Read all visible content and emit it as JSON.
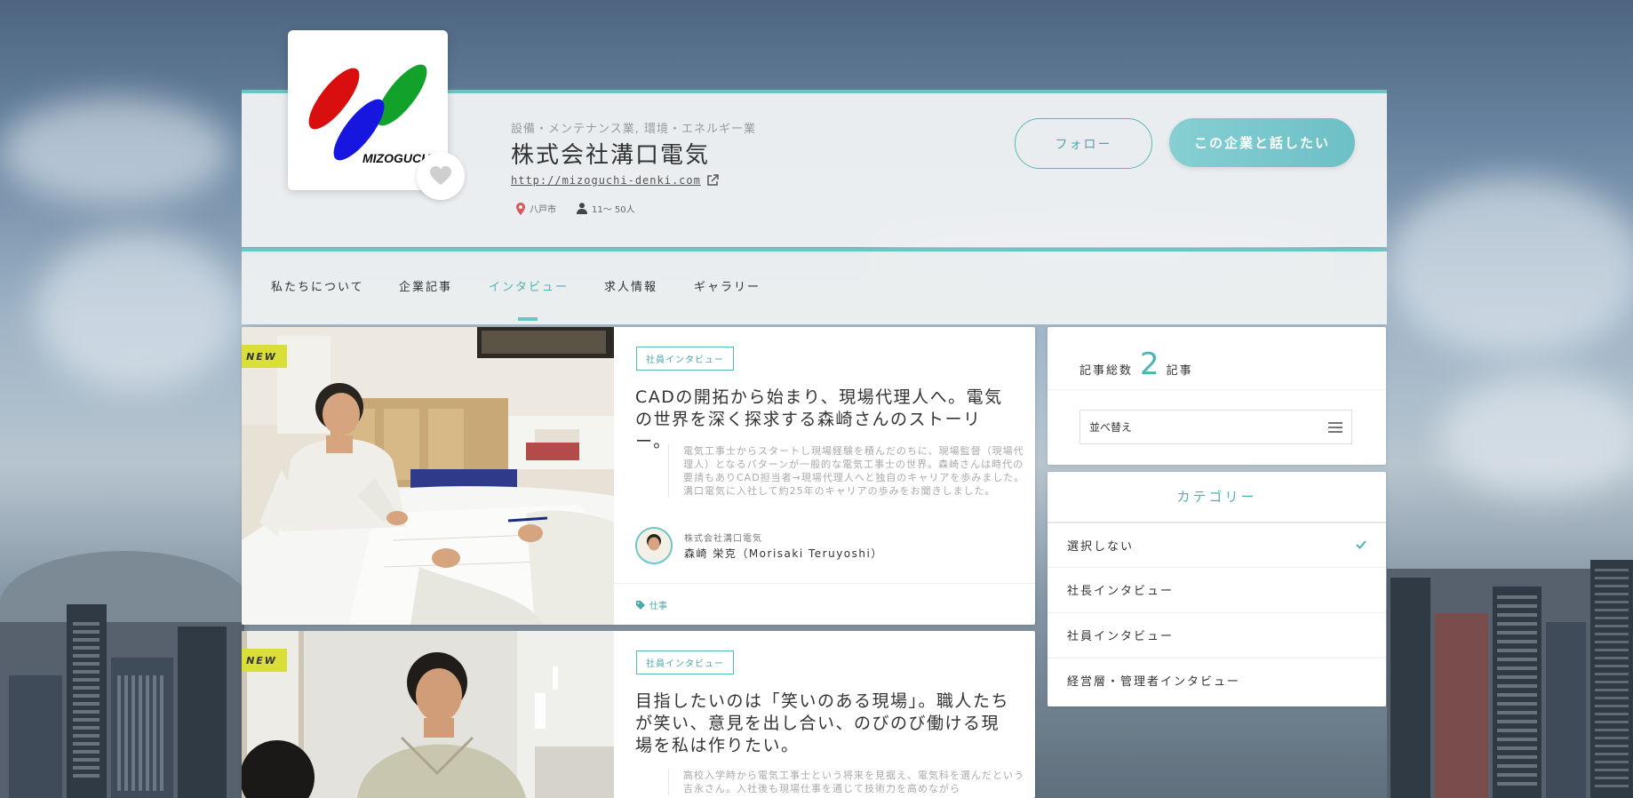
{
  "company": {
    "industry": "設備・メンテナンス業, 環境・エネルギー業",
    "name": "株式会社溝口電気",
    "url": "http://mizoguchi-denki.com",
    "location": "八戸市",
    "employees": "11～ 50人",
    "logo_text": "MIZOGUCHI"
  },
  "actions": {
    "follow": "フォロー",
    "talk": "この企業と話したい"
  },
  "nav": {
    "items": [
      "私たちについて",
      "企業記事",
      "インタビュー",
      "求人情報",
      "ギャラリー"
    ],
    "active": "インタビュー"
  },
  "articles": [
    {
      "badge": "NEW",
      "category": "社員インタビュー",
      "title": "CADの開拓から始まり、現場代理人へ。電気の世界を深く探求する森崎さんのストーリー。",
      "excerpt": "電気工事士からスタートし現場経験を積んだのちに、現場監督（現場代理人）となるパターンが一般的な電気工事士の世界。森崎さんは時代の要請もありCAD担当者→現場代理人へと独自のキャリアを歩みました。溝口電気に入社して約25年のキャリアの歩みをお聞きしました。",
      "author_company": "株式会社溝口電気",
      "author_name": "森崎 栄克（Morisaki Teruyoshi）",
      "tag": "仕事"
    },
    {
      "badge": "NEW",
      "category": "社員インタビュー",
      "title": "目指したいのは「笑いのある現場」。職人たちが笑い、意見を出し合い、のびのび働ける現場を私は作りたい。",
      "excerpt": "高校入学時から電気工事士という将来を見据え、電気科を選んだという吉永さん。入社後も現場仕事を通じて技術力を高めながら"
    }
  ],
  "sidebar": {
    "count_label_pre": "記事総数",
    "count": "2",
    "count_label_post": "記事",
    "sort_label": "並べ替え",
    "category_title": "カテゴリー",
    "categories": [
      "選択しない",
      "社長インタビュー",
      "社員インタビュー",
      "経営層・管理者インタビュー"
    ],
    "selected": "選択しない"
  },
  "colors": {
    "accent": "#6ec4c4",
    "badge": "#d9df37",
    "logo_red": "#d90f0f",
    "logo_blue": "#1616e0",
    "logo_green": "#12a12a"
  }
}
